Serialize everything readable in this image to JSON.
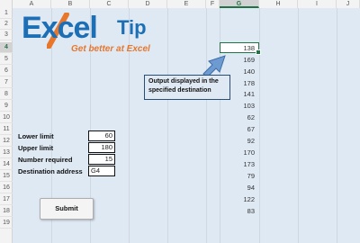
{
  "columns": [
    "A",
    "B",
    "C",
    "D",
    "E",
    "F",
    "G",
    "H",
    "I",
    "J"
  ],
  "selected_column": "G",
  "rows": [
    "1",
    "2",
    "3",
    "4",
    "5",
    "6",
    "7",
    "8",
    "9",
    "10",
    "11",
    "12",
    "13",
    "14",
    "15",
    "16",
    "17",
    "18",
    "19"
  ],
  "selected_row": "4",
  "logo": {
    "word1": "Excel",
    "word2": "Tip",
    "tagline": "Get better at Excel",
    "colors": {
      "blue": "#1c6fb5",
      "orange": "#e8762b"
    }
  },
  "output_values": [
    "138",
    "169",
    "140",
    "178",
    "141",
    "103",
    "62",
    "67",
    "92",
    "170",
    "173",
    "79",
    "94",
    "122",
    "83"
  ],
  "callout": {
    "text": "Output displayed in the specified destination"
  },
  "form": {
    "lower_limit_label": "Lower limit",
    "lower_limit_value": "60",
    "upper_limit_label": "Upper limit",
    "upper_limit_value": "180",
    "number_required_label": "Number required",
    "number_required_value": "15",
    "destination_label": "Destination address",
    "destination_value": "G4"
  },
  "submit_label": "Submit",
  "accent_color": "#217346"
}
